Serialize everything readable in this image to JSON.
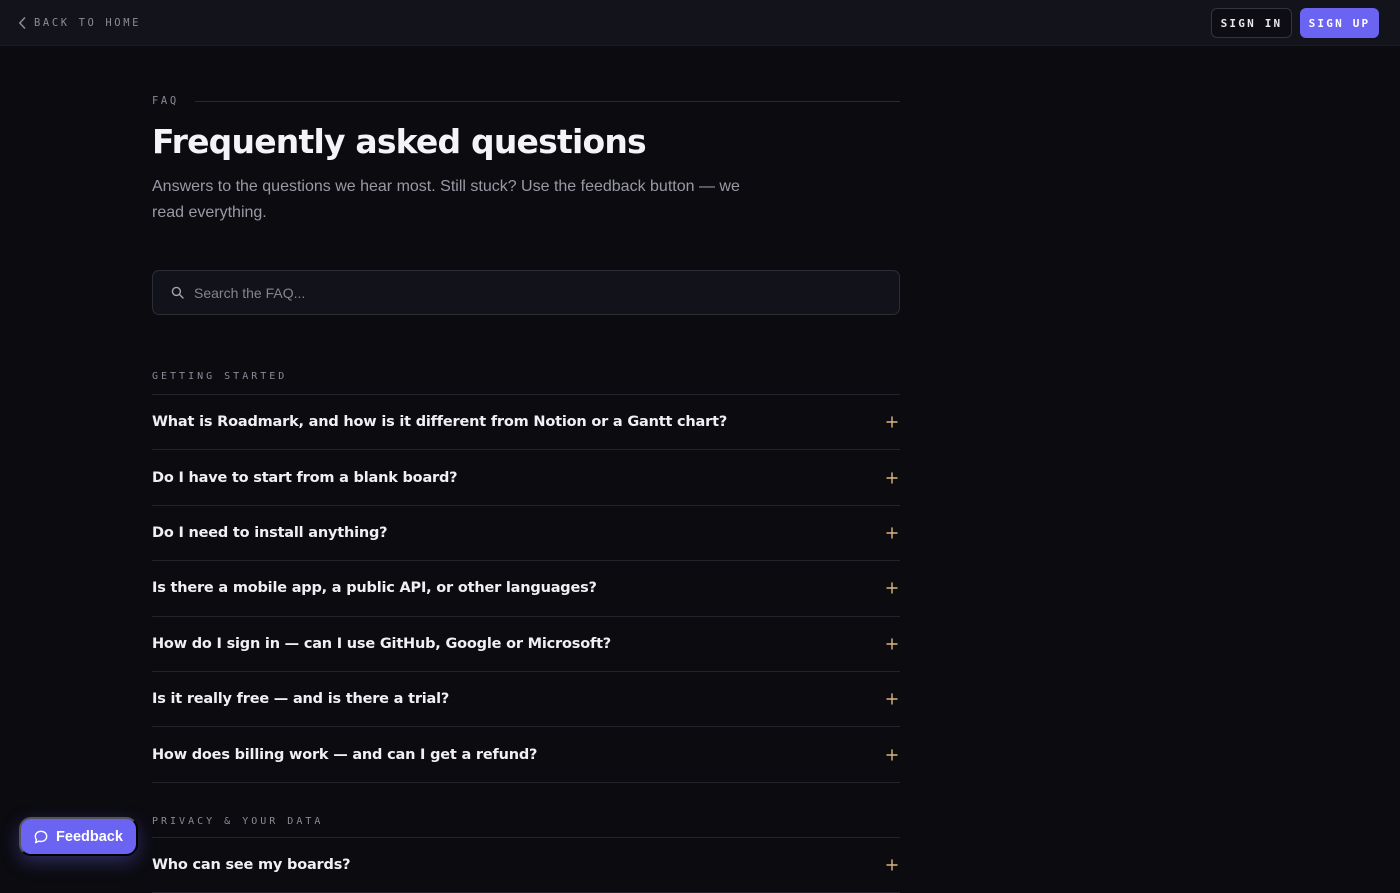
{
  "header": {
    "back_label": "BACK TO HOME",
    "sign_in_label": "SIGN IN",
    "sign_up_label": "SIGN UP"
  },
  "hero": {
    "eyebrow": "FAQ",
    "title": "Frequently asked questions",
    "subtitle": "Answers to the questions we hear most. Still stuck? Use the feedback button — we read everything."
  },
  "search": {
    "placeholder": "Search the FAQ...",
    "value": ""
  },
  "sections": [
    {
      "label": "GETTING STARTED",
      "questions": [
        "What is Roadmark, and how is it different from Notion or a Gantt chart?",
        "Do I have to start from a blank board?",
        "Do I need to install anything?",
        "Is there a mobile app, a public API, or other languages?",
        "How do I sign in — can I use GitHub, Google or Microsoft?",
        "Is it really free — and is there a trial?",
        "How does billing work — and can I get a refund?"
      ]
    },
    {
      "label": "PRIVACY & YOUR DATA",
      "questions": [
        "Who can see my boards?"
      ]
    }
  ],
  "feedback": {
    "label": "Feedback"
  },
  "icons": {
    "back": "chevron-left-icon",
    "search": "search-icon",
    "expand": "plus-icon",
    "feedback": "chat-bubble-icon"
  },
  "colors": {
    "background": "#0b0b10",
    "accent": "#6b63f2",
    "plus": "#d9b77a"
  }
}
